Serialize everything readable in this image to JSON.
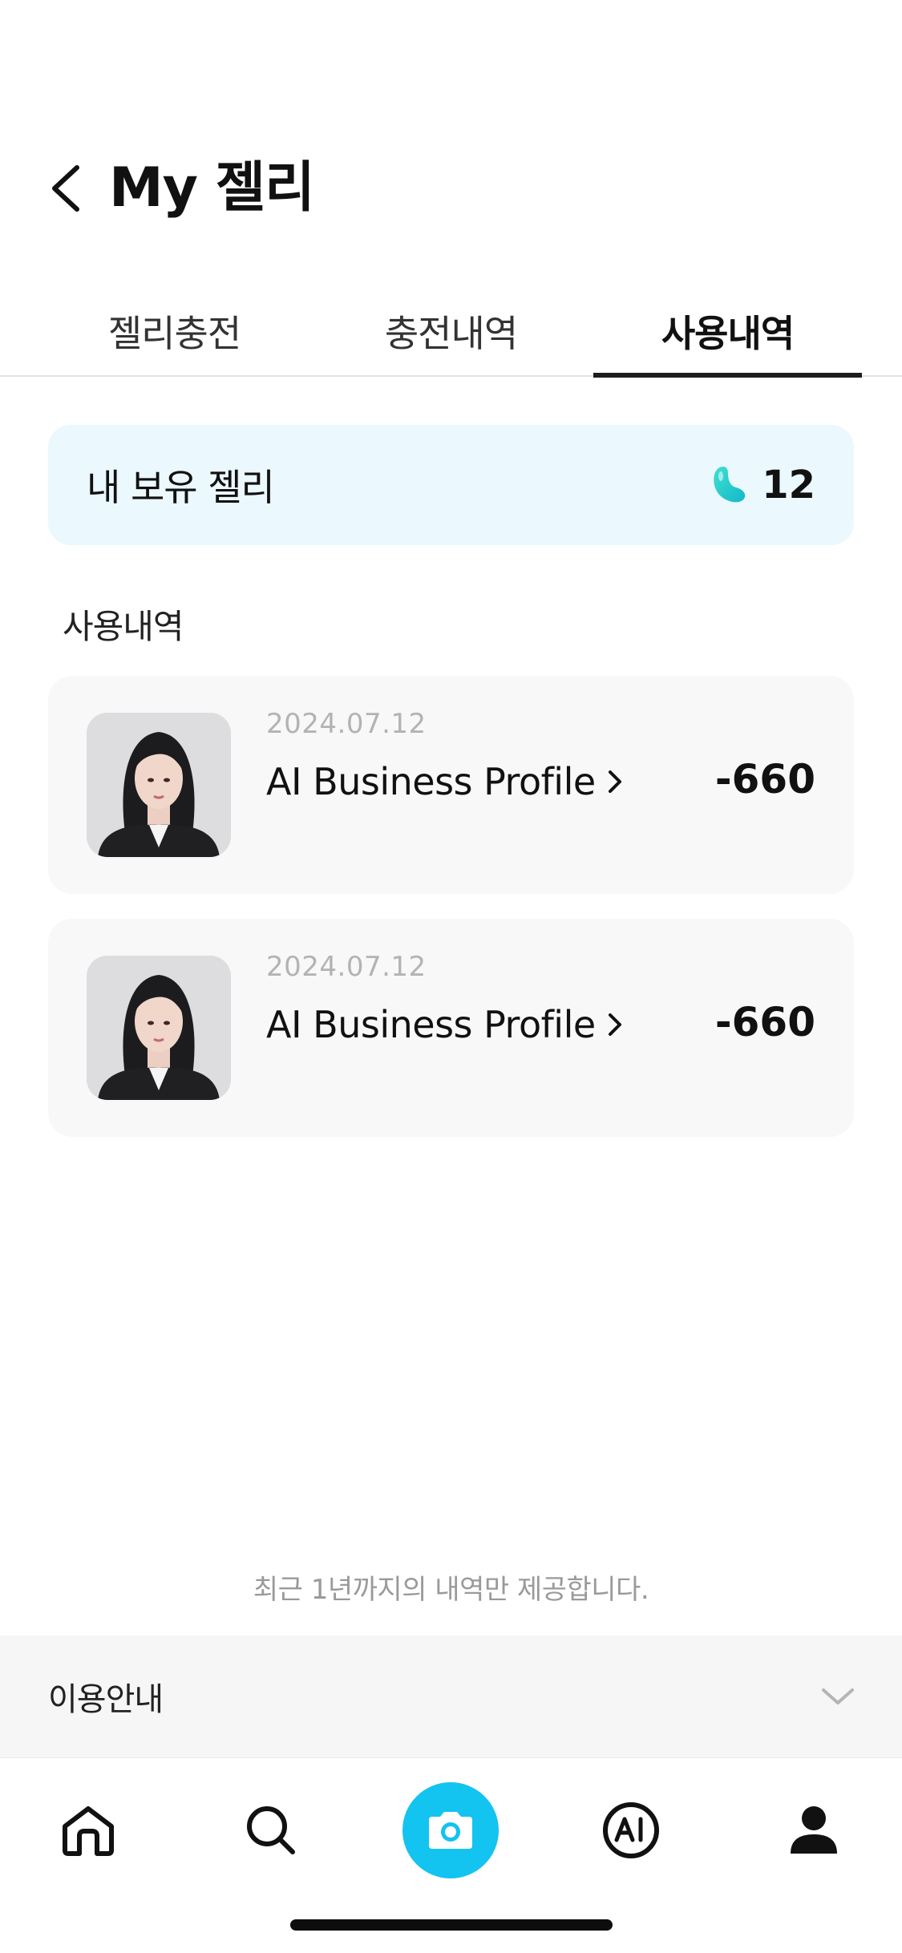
{
  "header": {
    "title": "My 젤리"
  },
  "tabs": [
    {
      "label": "젤리충전",
      "active": false
    },
    {
      "label": "충전내역",
      "active": false
    },
    {
      "label": "사용내역",
      "active": true
    }
  ],
  "balance": {
    "label": "내 보유 젤리",
    "value": "12",
    "icon": "jelly-bean-icon"
  },
  "history": {
    "section_title": "사용내역",
    "items": [
      {
        "date": "2024.07.12",
        "title": "AI Business Profile",
        "amount": "-660"
      },
      {
        "date": "2024.07.12",
        "title": "AI Business Profile",
        "amount": "-660"
      }
    ]
  },
  "footnote": "최근 1년까지의 내역만 제공합니다.",
  "guide": {
    "label": "이용안내"
  },
  "nav": {
    "items": [
      "home-icon",
      "search-icon",
      "camera-icon",
      "ai-icon",
      "profile-icon"
    ],
    "camera_color": "#13c3f0"
  },
  "colors": {
    "balance_bg": "#ebf8fd",
    "accent": "#13c3f0",
    "card_bg": "#f8f8f8"
  }
}
